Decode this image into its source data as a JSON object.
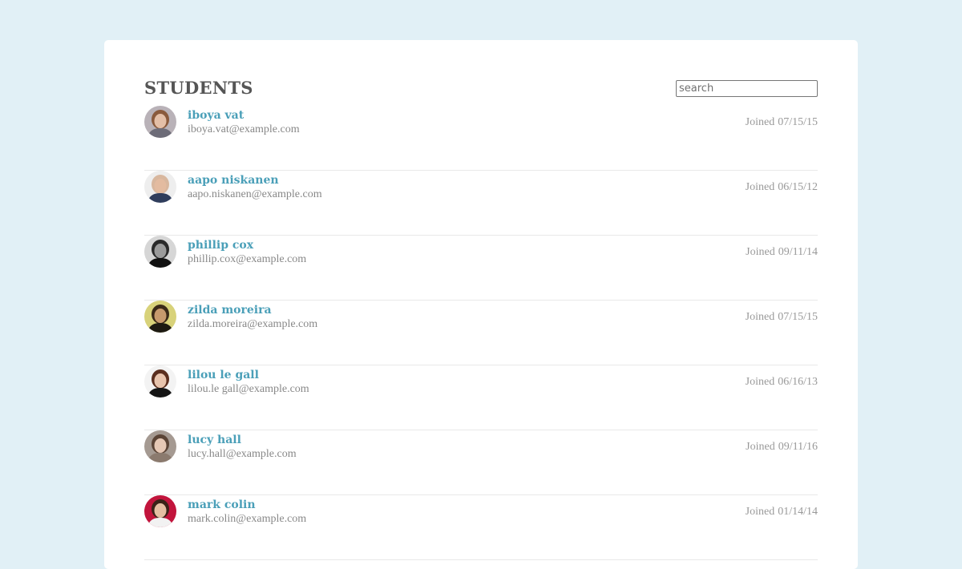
{
  "header": {
    "title": "STUDENTS",
    "search_placeholder": "search"
  },
  "students": [
    {
      "name": "iboya vat",
      "email": "iboya.vat@example.com",
      "joined_label": "Joined",
      "joined_date": "07/15/15",
      "avatar": {
        "bg": "#b9b2b8",
        "hair": "#8a5a3c",
        "skin": "#e4bfa7",
        "cloth": "#6d6c78"
      }
    },
    {
      "name": "aapo niskanen",
      "email": "aapo.niskanen@example.com",
      "joined_label": "Joined",
      "joined_date": "06/15/12",
      "avatar": {
        "bg": "#eeeeee",
        "hair": "#d8b79e",
        "skin": "#e3bba0",
        "cloth": "#2f3d5c"
      }
    },
    {
      "name": "phillip cox",
      "email": "phillip.cox@example.com",
      "joined_label": "Joined",
      "joined_date": "09/11/14",
      "avatar": {
        "bg": "#d6d6d6",
        "hair": "#2a2a2a",
        "skin": "#9b9b9b",
        "cloth": "#111111"
      }
    },
    {
      "name": "zilda moreira",
      "email": "zilda.moreira@example.com",
      "joined_label": "Joined",
      "joined_date": "07/15/15",
      "avatar": {
        "bg": "#d8d27a",
        "hair": "#3b2a18",
        "skin": "#c79a6d",
        "cloth": "#1d1a12"
      }
    },
    {
      "name": "lilou le gall",
      "email": "lilou.le gall@example.com",
      "joined_label": "Joined",
      "joined_date": "06/16/13",
      "avatar": {
        "bg": "#f3f3f3",
        "hair": "#5a2e1e",
        "skin": "#e8c4ad",
        "cloth": "#151515"
      }
    },
    {
      "name": "lucy hall",
      "email": "lucy.hall@example.com",
      "joined_label": "Joined",
      "joined_date": "09/11/16",
      "avatar": {
        "bg": "#a59a92",
        "hair": "#5b4436",
        "skin": "#e6c8b5",
        "cloth": "#8b7a6e"
      }
    },
    {
      "name": "mark colin",
      "email": "mark.colin@example.com",
      "joined_label": "Joined",
      "joined_date": "01/14/14",
      "avatar": {
        "bg": "#c2143c",
        "hair": "#3a2318",
        "skin": "#e5bfa3",
        "cloth": "#f2f2f2"
      }
    }
  ]
}
